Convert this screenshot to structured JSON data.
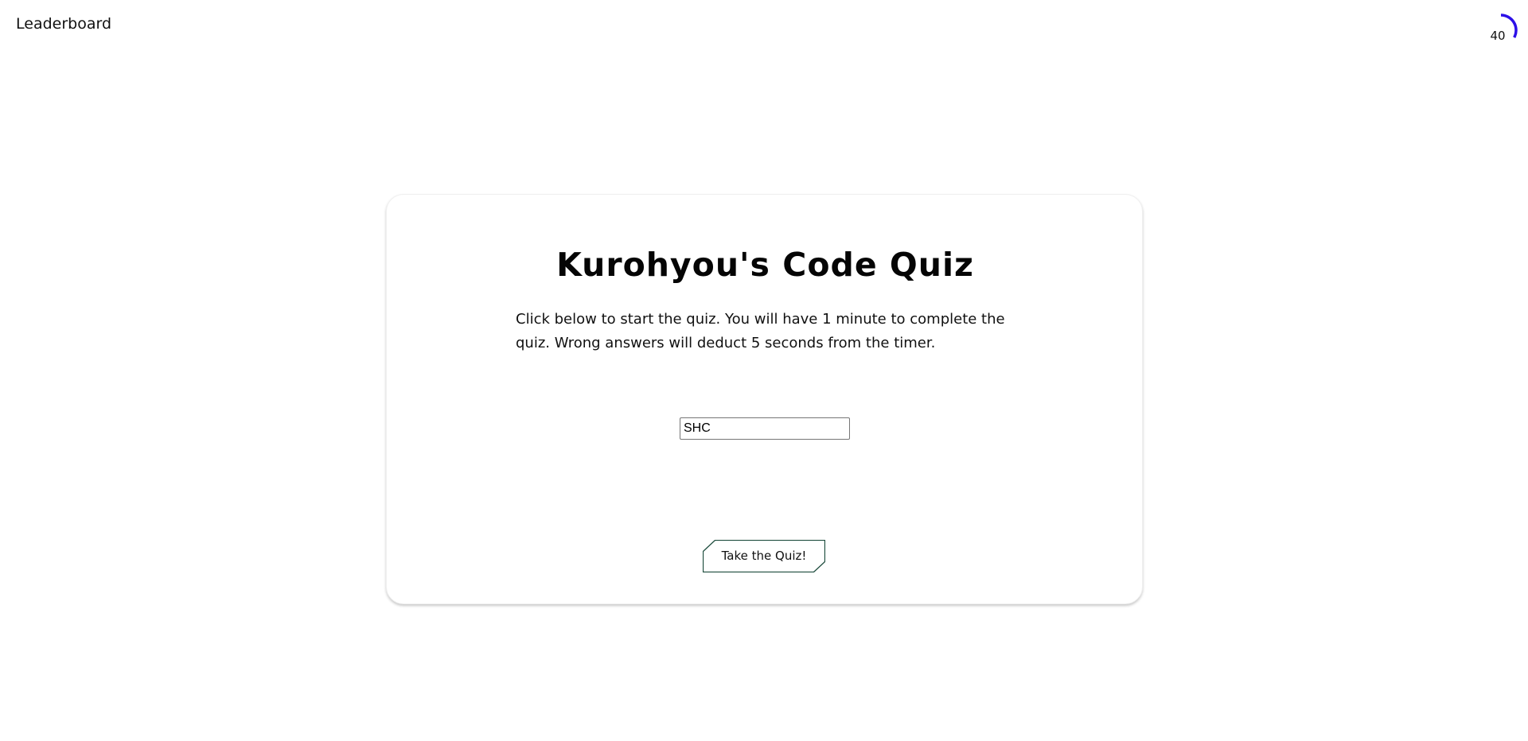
{
  "header": {
    "leaderboard_label": "Leaderboard",
    "timer": {
      "value": "40",
      "progress_fraction": 0.33,
      "ring_color": "#2d10e8"
    }
  },
  "quiz_card": {
    "title": "Kurohyou's Code Quiz",
    "description": "Click below to start the quiz. You will have 1 minute to complete the quiz. Wrong answers will deduct 5 seconds from the timer.",
    "initials_value": "SHC",
    "start_button_label": "Take the Quiz!",
    "button_border_color": "#1e4d3e"
  }
}
